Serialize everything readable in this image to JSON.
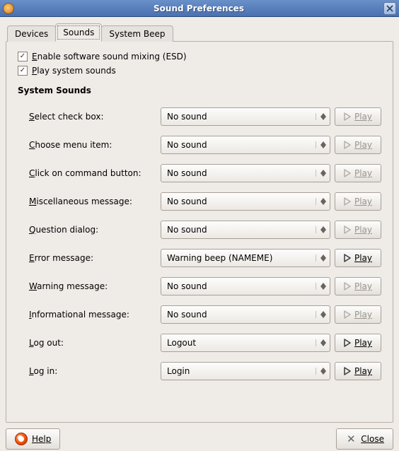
{
  "window": {
    "title": "Sound Preferences"
  },
  "tabs": [
    {
      "label": "Devices"
    },
    {
      "label": "Sounds"
    },
    {
      "label": "System Beep"
    }
  ],
  "active_tab": 1,
  "checkboxes": {
    "enable_esd": {
      "label": "Enable software sound mixing (ESD)",
      "underline": "E",
      "checked": true
    },
    "play_system": {
      "label": "Play system sounds",
      "underline": "P",
      "checked": true
    }
  },
  "section": "System Sounds",
  "rows": [
    {
      "label": "Select check box:",
      "underline": "S",
      "value": "No sound",
      "play_enabled": false
    },
    {
      "label": "Choose menu item:",
      "underline": "C",
      "value": "No sound",
      "play_enabled": false
    },
    {
      "label": "Click on command button:",
      "underline": "C",
      "value": "No sound",
      "play_enabled": false
    },
    {
      "label": "Miscellaneous message:",
      "underline": "M",
      "value": "No sound",
      "play_enabled": false
    },
    {
      "label": "Question dialog:",
      "underline": "Q",
      "value": "No sound",
      "play_enabled": false
    },
    {
      "label": "Error message:",
      "underline": "E",
      "value": "Warning beep (NAMEME)",
      "play_enabled": true
    },
    {
      "label": "Warning message:",
      "underline": "W",
      "value": "No sound",
      "play_enabled": false
    },
    {
      "label": "Informational message:",
      "underline": "I",
      "value": "No sound",
      "play_enabled": false
    },
    {
      "label": "Log out:",
      "underline": "L",
      "value": "Logout",
      "play_enabled": true
    },
    {
      "label": "Log in:",
      "underline": "L",
      "value": "Login",
      "play_enabled": true
    }
  ],
  "buttons": {
    "play": "Play",
    "help": "Help",
    "close": "Close"
  }
}
